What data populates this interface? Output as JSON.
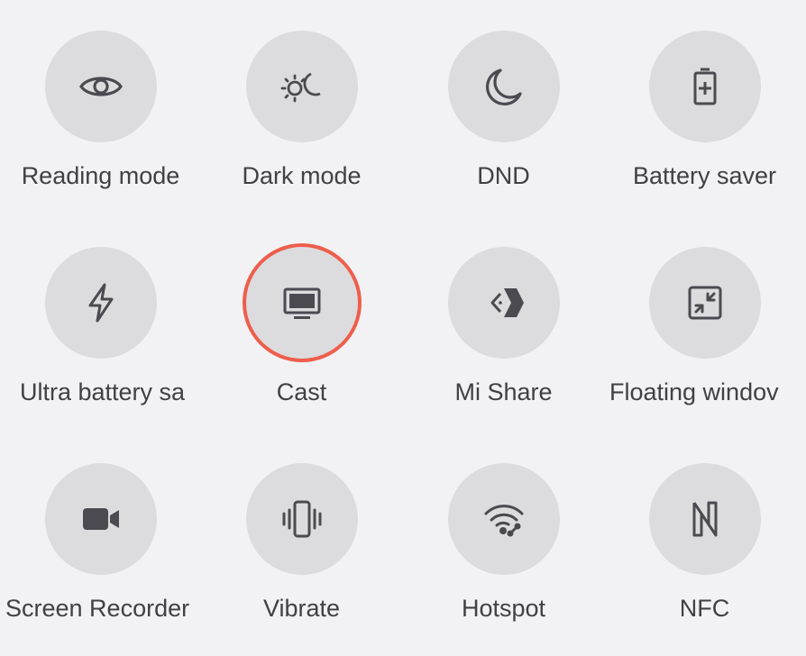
{
  "tiles": [
    {
      "label": "Reading mode",
      "icon": "eye-icon"
    },
    {
      "label": "Dark mode",
      "icon": "dark-mode-icon"
    },
    {
      "label": "DND",
      "icon": "moon-icon"
    },
    {
      "label": "Battery saver",
      "icon": "battery-plus-icon"
    },
    {
      "label": "Ultra battery sa",
      "icon": "lightning-icon"
    },
    {
      "label": "Cast",
      "icon": "monitor-icon"
    },
    {
      "label": "Mi Share",
      "icon": "mi-share-icon"
    },
    {
      "label": "Floating windov",
      "icon": "floating-window-icon"
    },
    {
      "label": "Screen Recorder",
      "icon": "video-camera-icon"
    },
    {
      "label": "Vibrate",
      "icon": "vibrate-icon"
    },
    {
      "label": "Hotspot",
      "icon": "hotspot-icon"
    },
    {
      "label": "NFC",
      "icon": "nfc-icon"
    }
  ],
  "highlighted_tile": "Cast",
  "colors": {
    "background": "#f2f2f4",
    "button": "#dcdcdf",
    "icon": "#4a4a50",
    "label": "#404045",
    "highlight_ring": "#ee5e4b"
  }
}
